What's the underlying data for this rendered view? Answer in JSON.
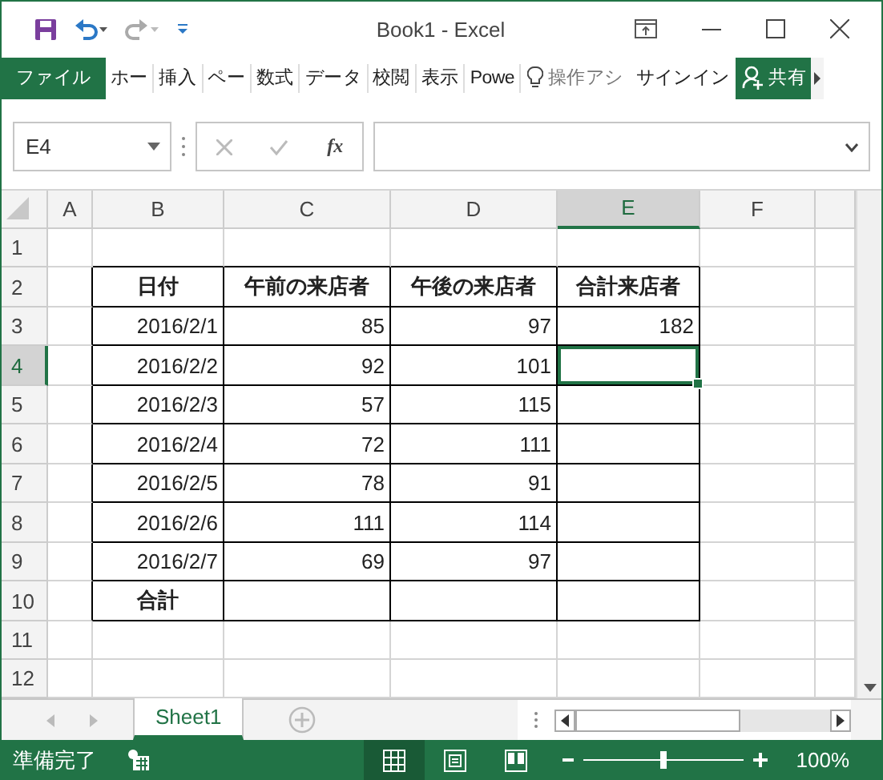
{
  "window": {
    "title": "Book1 - Excel"
  },
  "ribbon_tabs": [
    {
      "label": "ファイル",
      "kind": "file",
      "selected": false
    },
    {
      "label": "ホー",
      "kind": "tab",
      "selected": false
    },
    {
      "label": "挿入",
      "kind": "tab",
      "selected": false
    },
    {
      "label": "ペー",
      "kind": "tab",
      "selected": false
    },
    {
      "label": "数式",
      "kind": "tab",
      "selected": false
    },
    {
      "label": "データ",
      "kind": "tab",
      "selected": false
    },
    {
      "label": "校閲",
      "kind": "tab",
      "selected": false
    },
    {
      "label": "表示",
      "kind": "tab",
      "selected": false
    },
    {
      "label": "Powe",
      "kind": "tab",
      "selected": false
    }
  ],
  "tell_me": {
    "placeholder": "操作アシ"
  },
  "sign_in": "サインイン",
  "share_button": "共有",
  "formula_bar": {
    "name_box": "E4",
    "function_button": "fx"
  },
  "sheet": {
    "columns": [
      {
        "label": "A",
        "selected": false
      },
      {
        "label": "B",
        "selected": false
      },
      {
        "label": "C",
        "selected": false
      },
      {
        "label": "D",
        "selected": false
      },
      {
        "label": "E",
        "selected": true
      },
      {
        "label": "F",
        "selected": false
      }
    ],
    "rows": [
      {
        "number": "1",
        "selected": false
      },
      {
        "number": "2",
        "selected": false,
        "kind": "heading",
        "cells": [
          {
            "text": "日付",
            "selected": false
          },
          {
            "text": "午前の来店者",
            "selected": false
          },
          {
            "text": "午後の来店者",
            "selected": false
          },
          {
            "text": "合計来店者",
            "selected": false
          }
        ]
      },
      {
        "number": "3",
        "selected": false,
        "kind": "data",
        "cells": [
          {
            "text": "2016/2/1",
            "selected": false
          },
          {
            "text": "85",
            "selected": false
          },
          {
            "text": "97",
            "selected": false
          },
          {
            "text": "182",
            "selected": false
          }
        ]
      },
      {
        "number": "4",
        "selected": true,
        "kind": "data",
        "cells": [
          {
            "text": "2016/2/2",
            "selected": false
          },
          {
            "text": "92",
            "selected": false
          },
          {
            "text": "101",
            "selected": false
          },
          {
            "selected": true
          }
        ]
      },
      {
        "number": "5",
        "selected": false,
        "kind": "data",
        "cells": [
          {
            "text": "2016/2/3",
            "selected": false
          },
          {
            "text": "57",
            "selected": false
          },
          {
            "text": "115",
            "selected": false
          },
          {
            "selected": false
          }
        ]
      },
      {
        "number": "6",
        "selected": false,
        "kind": "data",
        "cells": [
          {
            "text": "2016/2/4",
            "selected": false
          },
          {
            "text": "72",
            "selected": false
          },
          {
            "text": "111",
            "selected": false
          },
          {
            "selected": false
          }
        ]
      },
      {
        "number": "7",
        "selected": false,
        "kind": "data",
        "cells": [
          {
            "text": "2016/2/5",
            "selected": false
          },
          {
            "text": "78",
            "selected": false
          },
          {
            "text": "91",
            "selected": false
          },
          {
            "selected": false
          }
        ]
      },
      {
        "number": "8",
        "selected": false,
        "kind": "data",
        "cells": [
          {
            "text": "2016/2/6",
            "selected": false
          },
          {
            "text": "111",
            "selected": false
          },
          {
            "text": "114",
            "selected": false
          },
          {
            "selected": false
          }
        ]
      },
      {
        "number": "9",
        "selected": false,
        "kind": "data",
        "cells": [
          {
            "text": "2016/2/7",
            "selected": false
          },
          {
            "text": "69",
            "selected": false
          },
          {
            "text": "97",
            "selected": false
          },
          {
            "selected": false
          }
        ]
      },
      {
        "number": "10",
        "selected": false,
        "kind": "heading",
        "cells": [
          {
            "text": "合計",
            "selected": false
          },
          {
            "selected": false
          },
          {
            "selected": false
          },
          {
            "selected": false
          }
        ]
      },
      {
        "number": "11",
        "selected": false
      },
      {
        "number": "12",
        "selected": false
      }
    ]
  },
  "sheet_tabs": [
    {
      "label": "Sheet1",
      "selected": true
    }
  ],
  "status_bar": {
    "status": "準備完了",
    "views": [
      {
        "kind": "normal",
        "selected": true
      },
      {
        "kind": "layout",
        "selected": false
      },
      {
        "kind": "pagebreak",
        "selected": false
      }
    ],
    "zoom": {
      "level": 0.5,
      "reading": "100%"
    }
  }
}
